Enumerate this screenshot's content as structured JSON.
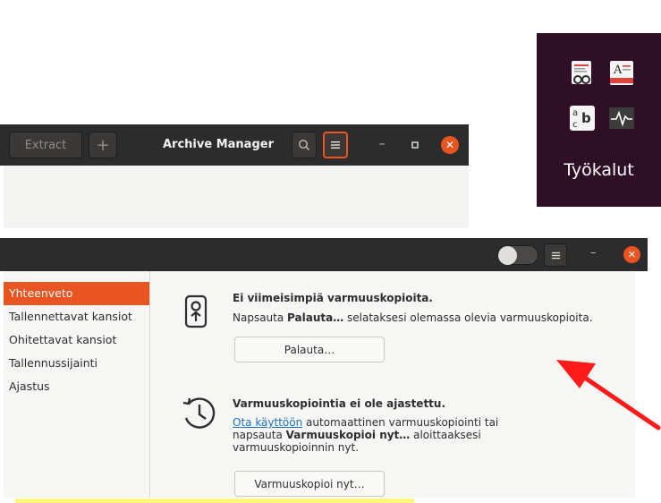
{
  "archive_manager": {
    "extract_label": "Extract",
    "add_label": "+",
    "title": "Archive Manager",
    "search_icon": "search-icon",
    "menu_icon": "hamburger-icon",
    "minimize_label": "–",
    "close_label": "✕"
  },
  "tools_folder": {
    "label": "Työkalut",
    "icons": [
      "document-viewer-icon",
      "font-viewer-icon",
      "character-map-icon",
      "system-monitor-icon"
    ]
  },
  "backups": {
    "minimize_label": "–",
    "close_label": "✕",
    "sidebar": [
      {
        "label": "Yhteenveto",
        "active": true
      },
      {
        "label": "Tallennettavat kansiot",
        "active": false
      },
      {
        "label": "Ohitettavat kansiot",
        "active": false
      },
      {
        "label": "Tallennussijainti",
        "active": false
      },
      {
        "label": "Ajastus",
        "active": false
      }
    ],
    "restore": {
      "heading": "Ei viimeisimpiä varmuuskopioita.",
      "text_before": "Napsauta ",
      "text_bold": "Palauta…",
      "text_after": " selataksesi olemassa olevia varmuuskopioita.",
      "button_label": "Palauta…"
    },
    "schedule": {
      "heading": "Varmuuskopiointia ei ole ajastettu.",
      "link_label": "Ota käyttöön",
      "line1_after": " automaattinen varmuuskopiointi tai",
      "line2_before": "napsauta ",
      "line2_bold": "Varmuuskopioi nyt…",
      "line2_after": " aloittaaksesi",
      "line3": "varmuuskopioinnin nyt.",
      "button_label": "Varmuuskopioi nyt…"
    }
  },
  "colors": {
    "accent": "#e95420",
    "headerbar": "#2d2c2c",
    "tools_bg": "#2f0f25",
    "annotation_arrow": "#ff1a1a",
    "annotation_highlight": "#fff77a"
  }
}
